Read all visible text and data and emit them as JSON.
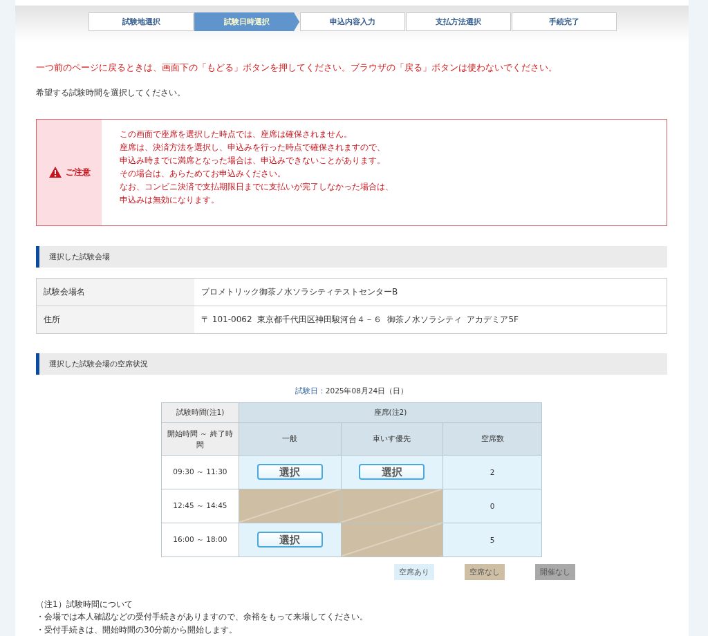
{
  "steps": [
    {
      "label": "試験地選択",
      "selected": false
    },
    {
      "label": "試験日時選択",
      "selected": true
    },
    {
      "label": "申込内容入力",
      "selected": false
    },
    {
      "label": "支払方法選択",
      "selected": false
    },
    {
      "label": "手続完了",
      "selected": false
    }
  ],
  "back_warning": "一つ前のページに戻るときは、画面下の「もどる」ボタンを押してください。ブラウザの「戻る」ボタンは使わないでください。",
  "instruction": "希望する試験時間を選択してください。",
  "notice": {
    "label": "ご注意",
    "lines": [
      "この画面で座席を選択した時点では、座席は確保されません。",
      "座席は、決済方法を選択し、申込みを行った時点で確保されますので、",
      "申込み時までに満席となった場合は、申込みできないことがあります。",
      "その場合は、あらためてお申込みください。",
      "なお、コンビニ決済で支払期限日までに支払いが完了しなかった場合は、",
      "申込みは無効になります。"
    ]
  },
  "venue_section": {
    "heading": "選択した試験会場",
    "rows": [
      {
        "label": "試験会場名",
        "value": "プロメトリック御茶ノ水ソラシティテストセンターB"
      },
      {
        "label": "住所",
        "value": "〒 101-0062  東京都千代田区神田駿河台４－６  御茶ノ水ソラシティ  アカデミア5F"
      }
    ]
  },
  "availability_section": {
    "heading": "選択した試験会場の空席状況",
    "date_label": "試験日：",
    "date": "2025年08月24日（日）",
    "header": {
      "time_group": "試験時間(注1)",
      "seat_group": "座席(注2)",
      "time_column": "開始時間 ～ 終了時間",
      "columns": [
        "一般",
        "車いす優先",
        "空席数"
      ]
    },
    "rows": [
      {
        "time": "09:30 ～ 11:30",
        "seats": [
          {
            "kind": "available",
            "button": "選択"
          },
          {
            "kind": "available",
            "button": "選択"
          }
        ],
        "count": "2"
      },
      {
        "time": "12:45 ～ 14:45",
        "seats": [
          {
            "kind": "full"
          },
          {
            "kind": "full"
          }
        ],
        "count": "0"
      },
      {
        "time": "16:00 ～ 18:00",
        "seats": [
          {
            "kind": "available",
            "button": "選択"
          },
          {
            "kind": "full"
          }
        ],
        "count": "5"
      }
    ],
    "legend": [
      {
        "label": "空席あり",
        "kind": "available"
      },
      {
        "label": "空席なし",
        "kind": "full"
      },
      {
        "label": "開催なし",
        "kind": "none"
      }
    ]
  },
  "notes": {
    "title": "（注1）試験時間について",
    "lines": [
      "・会場では本人確認などの受付手続きがありますので、余裕をもって来場してください。",
      "・受付手続きは、開始時間の30分前から開始します。"
    ]
  }
}
